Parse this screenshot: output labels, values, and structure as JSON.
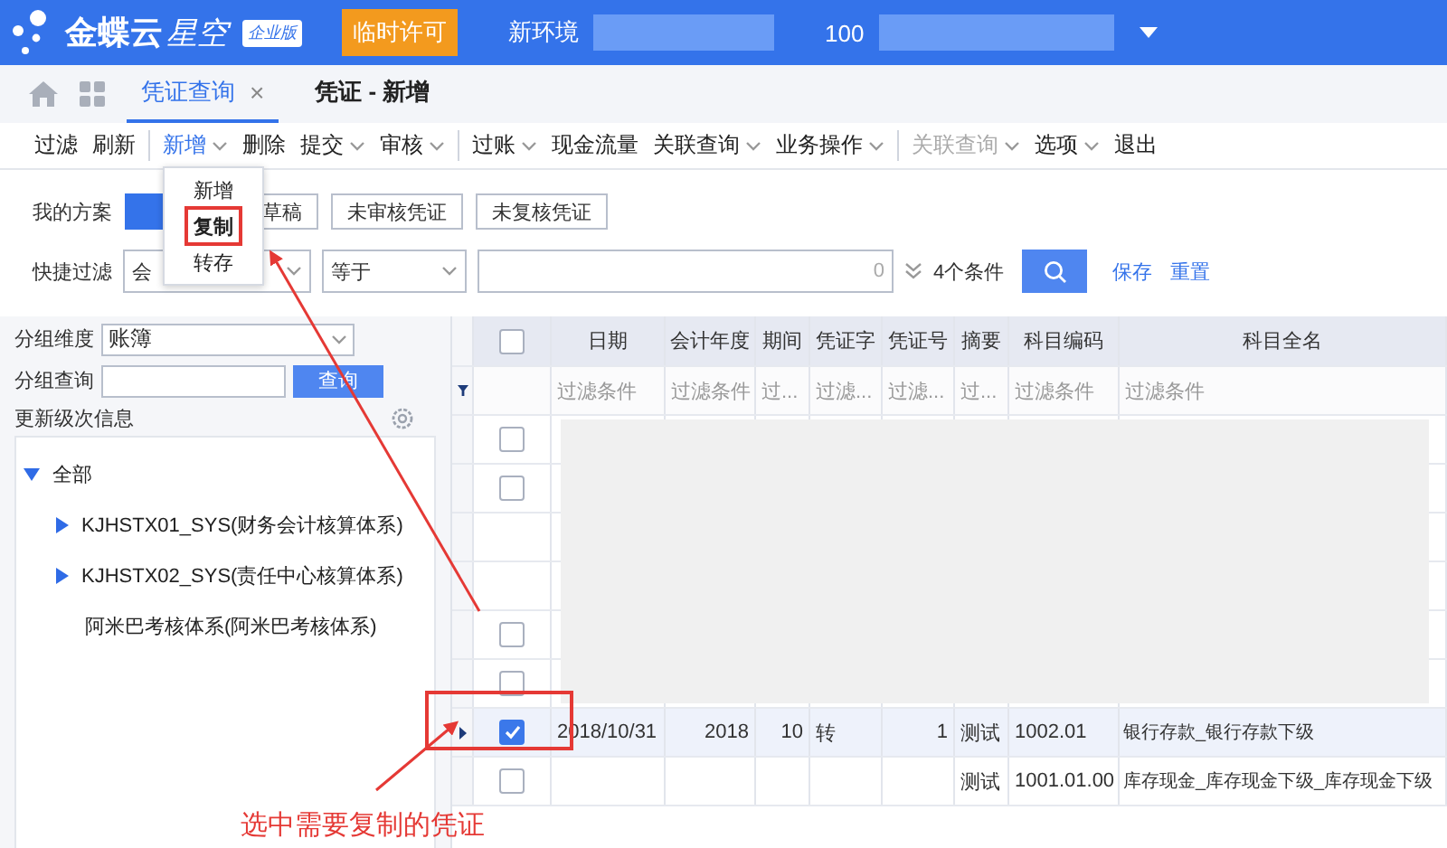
{
  "header": {
    "brand": "金蝶云",
    "brand_sub": "星空",
    "edition": "企业版",
    "license_button": "临时许可",
    "env_label": "新环境",
    "org_label": "100"
  },
  "tabs": [
    {
      "label": "凭证查询",
      "selected": true,
      "close": "×"
    },
    {
      "label": "凭证 - 新增",
      "selected": false
    }
  ],
  "toolbar": [
    [
      {
        "label": "过滤",
        "kind": "button",
        "disabled": false
      },
      {
        "label": "刷新",
        "kind": "button",
        "disabled": false
      }
    ],
    [
      {
        "label": "新增",
        "kind": "dropdown",
        "disabled": false,
        "active": true
      },
      {
        "label": "删除",
        "kind": "button",
        "disabled": false
      },
      {
        "label": "提交",
        "kind": "dropdown",
        "disabled": false
      },
      {
        "label": "审核",
        "kind": "dropdown",
        "disabled": false
      }
    ],
    [
      {
        "label": "过账",
        "kind": "dropdown",
        "disabled": false
      },
      {
        "label": "现金流量",
        "kind": "button",
        "disabled": false
      },
      {
        "label": "关联查询",
        "kind": "dropdown",
        "disabled": false
      },
      {
        "label": "业务操作",
        "kind": "dropdown",
        "disabled": false
      }
    ],
    [
      {
        "label": "关联查询",
        "kind": "dropdown",
        "disabled": true
      },
      {
        "label": "选项",
        "kind": "dropdown",
        "disabled": false
      },
      {
        "label": "退出",
        "kind": "button",
        "disabled": false
      }
    ]
  ],
  "menu": {
    "items": [
      {
        "label": "新增",
        "highlighted": false
      },
      {
        "label": "复制",
        "highlighted": true
      },
      {
        "label": "转存",
        "highlighted": false
      }
    ]
  },
  "schemes": {
    "label": "我的方案",
    "items": [
      {
        "selected": true
      },
      {
        "label": "草稿",
        "selected": false
      },
      {
        "label": "未审核凭证",
        "selected": false
      },
      {
        "label": "未复核凭证",
        "selected": false
      }
    ]
  },
  "quick_filter": {
    "label": "快捷过滤",
    "field": "会",
    "operator": "等于",
    "value_count": "0",
    "conditions": "4个条件",
    "save": "保存",
    "reset": "重置"
  },
  "left": {
    "dimension_label": "分组维度",
    "dimension_value": "账簿",
    "query_label": "分组查询",
    "query_button": "查询",
    "level_info": "更新级次信息",
    "tree": [
      {
        "label": "全部",
        "kind": "node",
        "expanded": true,
        "children": [
          {
            "label": "KJHSTX01_SYS(财务会计核算体系)",
            "kind": "node",
            "expanded": false
          },
          {
            "label": "KJHSTX02_SYS(责任中心核算体系)",
            "kind": "node",
            "expanded": false
          },
          {
            "label": "阿米巴考核体系(阿米巴考核体系)",
            "kind": "leaf"
          }
        ]
      }
    ]
  },
  "table": {
    "columns": [
      "日期",
      "会计年度",
      "期间",
      "凭证字",
      "凭证号",
      "摘要",
      "科目编码",
      "科目全名"
    ],
    "filters": [
      "过滤条件",
      "过滤条件",
      "过...",
      "过滤...",
      "过滤...",
      "过...",
      "过滤条件",
      "过滤条件"
    ],
    "select_all_checked": false,
    "rows": [
      {
        "kind": "row",
        "checked": false,
        "current": false,
        "cells": []
      },
      {
        "kind": "row",
        "checked": false,
        "current": false,
        "cells": []
      },
      {
        "kind": "hidden",
        "current": false,
        "cells": []
      },
      {
        "kind": "hidden",
        "current": false,
        "cells": []
      },
      {
        "kind": "row",
        "checked": false,
        "current": false,
        "cells": []
      },
      {
        "kind": "row",
        "checked": false,
        "current": false,
        "cells": []
      },
      {
        "kind": "row",
        "checked": true,
        "current": true,
        "cells": [
          "2018/10/31",
          "2018",
          "10",
          "转",
          "1",
          "测试",
          "1002.01",
          "银行存款_银行存款下级"
        ]
      },
      {
        "kind": "row",
        "checked": false,
        "current": false,
        "cells": [
          null,
          null,
          null,
          null,
          null,
          "测试",
          "1001.01.00",
          "库存现金_库存现金下级_库存现金下级"
        ]
      }
    ]
  },
  "annotation": {
    "caption": "选中需要复制的凭证"
  }
}
